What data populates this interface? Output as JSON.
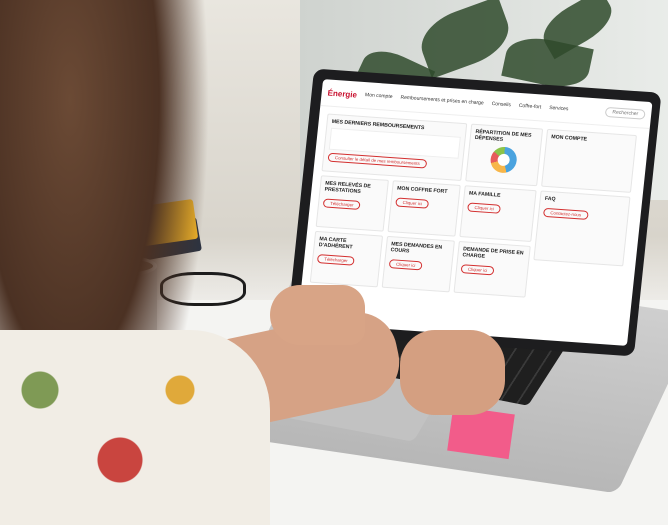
{
  "scene": {
    "description_hidden": ""
  },
  "screen": {
    "app_title": "Énergie",
    "nav_links": [
      "Mon compte",
      "Remboursements et prises en charge",
      "Conseils",
      "Coffre-fort",
      "Services"
    ],
    "search_placeholder": "Rechercher",
    "cards": {
      "refunds_title": "MES DERNIERS REMBOURSEMENTS",
      "refunds_button": "Consulter le détail de mes remboursements",
      "distribution_title": "RÉPARTITION DE MES DÉPENSES",
      "account_title": "MON COMPTE",
      "statements_title": "MES RELEVÉS DE PRESTATIONS",
      "statements_button": "Télécharger",
      "vault_title": "MON COFFRE FORT",
      "vault_button": "Cliquer ici",
      "family_title": "MA FAMILLE",
      "family_button": "Cliquer ici",
      "card_title": "MA CARTE D'ADHÉRENT",
      "card_button": "Télécharger",
      "requests_title": "MES DEMANDES EN COURS",
      "requests_button": "Cliquer ici",
      "claim_title": "DEMANDE DE PRISE EN CHARGE",
      "claim_button": "Cliquer ici",
      "faq_title": "FAQ",
      "faq_button": "Contactez-nous"
    }
  },
  "colors": {
    "accent_red": "#d32f2f",
    "sticky_pink": "#f25c8a",
    "book_yellow": "#f0b429"
  }
}
